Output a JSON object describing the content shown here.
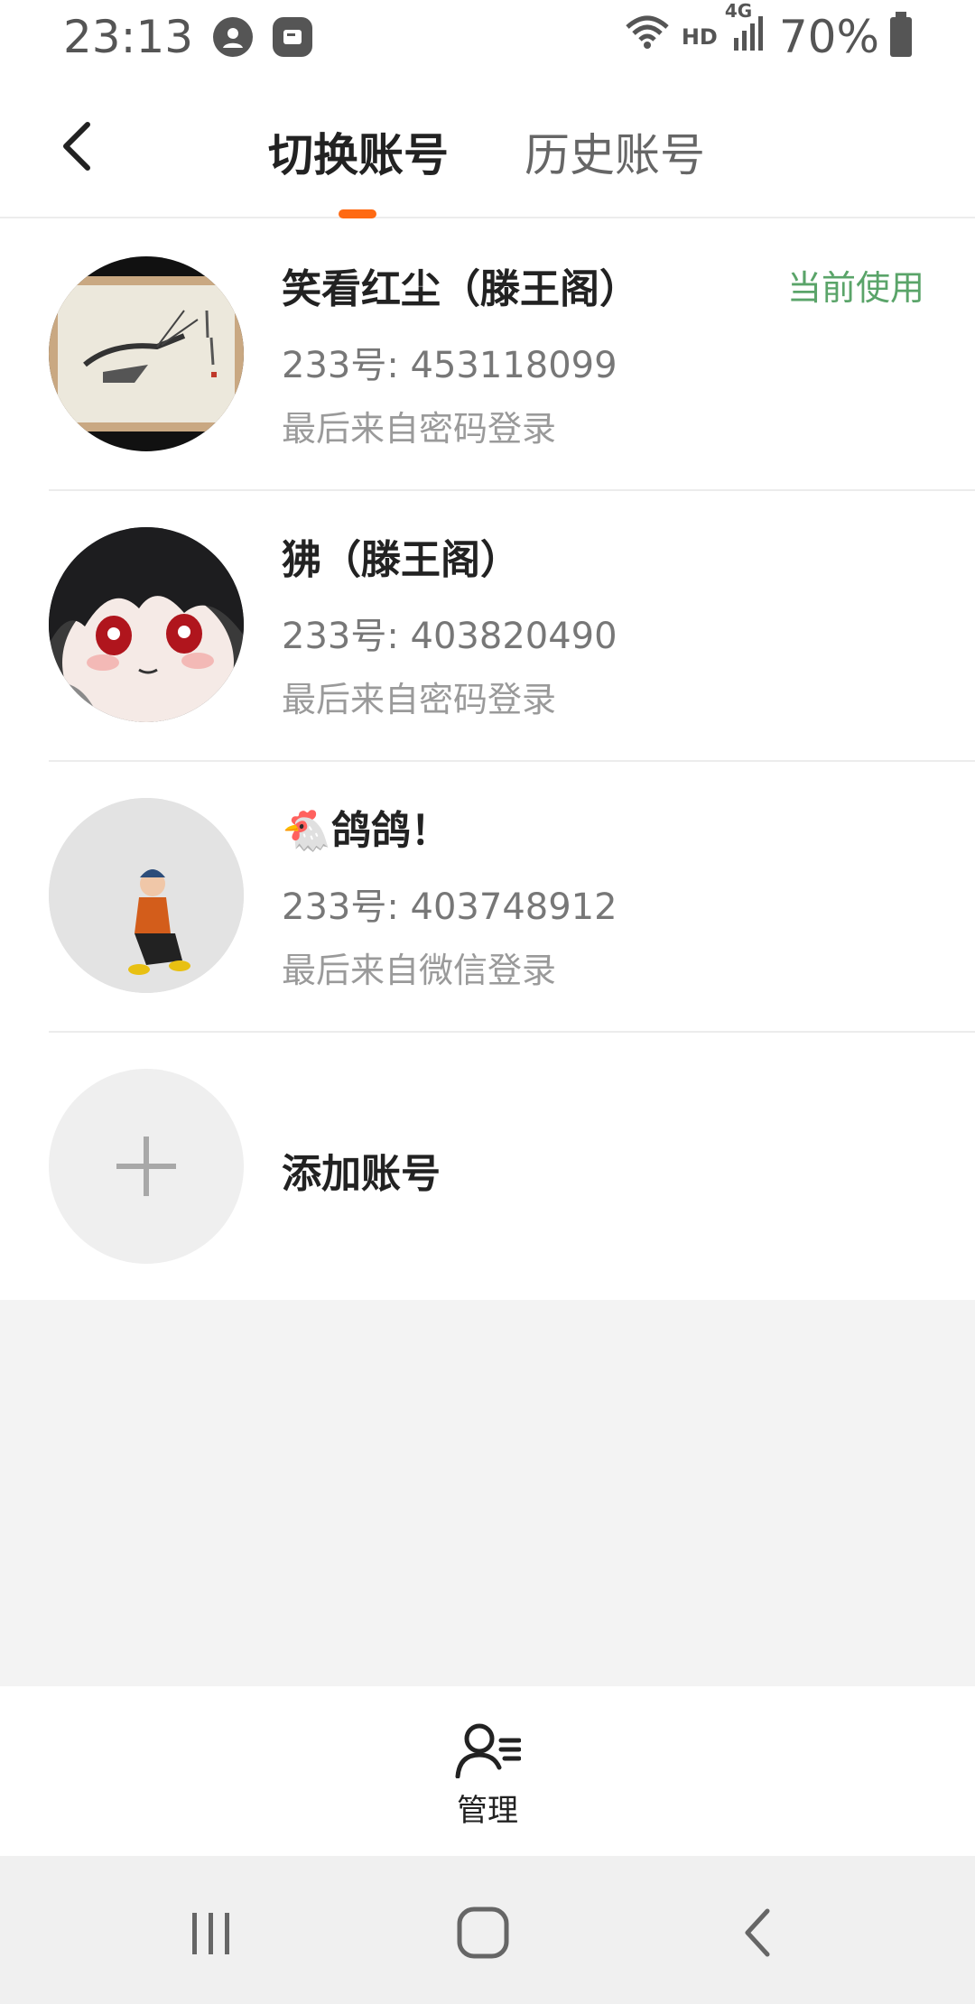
{
  "status_bar": {
    "time": "23:13",
    "network": "HD",
    "signal_label": "4G",
    "battery": "70%",
    "icons": [
      "account-circle-icon",
      "app-notification-icon",
      "wifi-icon",
      "signal-icon",
      "battery-icon"
    ]
  },
  "header": {
    "tabs": [
      {
        "label": "切换账号",
        "active": true
      },
      {
        "label": "历史账号",
        "active": false
      }
    ],
    "accent_color": "#ff6a13"
  },
  "accounts": [
    {
      "name": "笑看红尘（滕王阁）",
      "id": "233号: 453118099",
      "login": "最后来自密码登录",
      "current": "当前使用",
      "avatar": "shrimp-painting"
    },
    {
      "name": "狒（滕王阁）",
      "id": "233号: 403820490",
      "login": "最后来自密码登录",
      "avatar": "anime-girl"
    },
    {
      "name": "🐔鸽鸽！",
      "id": "233号: 403748912",
      "login": "最后来自微信登录",
      "avatar": "crouching-character"
    }
  ],
  "add_account": {
    "label": "添加账号"
  },
  "bottom_tab": {
    "label": "管理",
    "icon": "user-manage-icon"
  },
  "nav": {
    "icons": [
      "recent-apps-icon",
      "home-icon",
      "back-icon"
    ]
  },
  "colors": {
    "current_badge": "#5aa469",
    "gray_bg": "#f3f3f3"
  }
}
